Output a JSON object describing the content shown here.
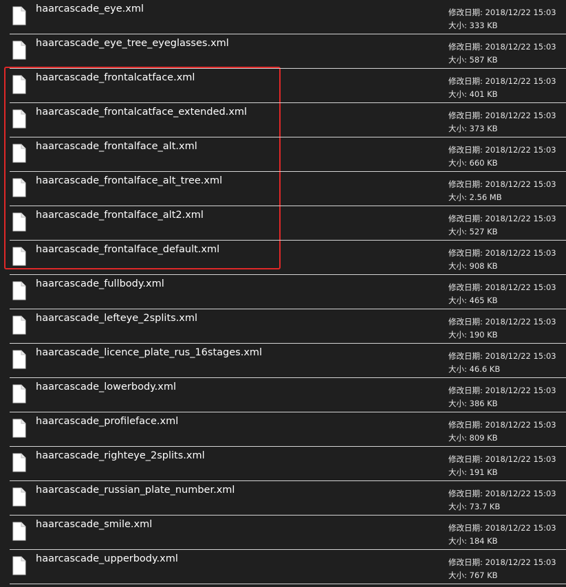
{
  "labels": {
    "modified": "修改日期:",
    "size": "大小:"
  },
  "highlight_color": "#e02828",
  "files": [
    {
      "name": "haarcascade_eye.xml",
      "modified": "2018/12/22 15:03",
      "size": "333 KB",
      "highlighted": false
    },
    {
      "name": "haarcascade_eye_tree_eyeglasses.xml",
      "modified": "2018/12/22 15:03",
      "size": "587 KB",
      "highlighted": false
    },
    {
      "name": "haarcascade_frontalcatface.xml",
      "modified": "2018/12/22 15:03",
      "size": "401 KB",
      "highlighted": true
    },
    {
      "name": "haarcascade_frontalcatface_extended.xml",
      "modified": "2018/12/22 15:03",
      "size": "373 KB",
      "highlighted": true
    },
    {
      "name": "haarcascade_frontalface_alt.xml",
      "modified": "2018/12/22 15:03",
      "size": "660 KB",
      "highlighted": true
    },
    {
      "name": "haarcascade_frontalface_alt_tree.xml",
      "modified": "2018/12/22 15:03",
      "size": "2.56 MB",
      "highlighted": true
    },
    {
      "name": "haarcascade_frontalface_alt2.xml",
      "modified": "2018/12/22 15:03",
      "size": "527 KB",
      "highlighted": true
    },
    {
      "name": "haarcascade_frontalface_default.xml",
      "modified": "2018/12/22 15:03",
      "size": "908 KB",
      "highlighted": true
    },
    {
      "name": "haarcascade_fullbody.xml",
      "modified": "2018/12/22 15:03",
      "size": "465 KB",
      "highlighted": false
    },
    {
      "name": "haarcascade_lefteye_2splits.xml",
      "modified": "2018/12/22 15:03",
      "size": "190 KB",
      "highlighted": false
    },
    {
      "name": "haarcascade_licence_plate_rus_16stages.xml",
      "modified": "2018/12/22 15:03",
      "size": "46.6 KB",
      "highlighted": false
    },
    {
      "name": "haarcascade_lowerbody.xml",
      "modified": "2018/12/22 15:03",
      "size": "386 KB",
      "highlighted": false
    },
    {
      "name": "haarcascade_profileface.xml",
      "modified": "2018/12/22 15:03",
      "size": "809 KB",
      "highlighted": false
    },
    {
      "name": "haarcascade_righteye_2splits.xml",
      "modified": "2018/12/22 15:03",
      "size": "191 KB",
      "highlighted": false
    },
    {
      "name": "haarcascade_russian_plate_number.xml",
      "modified": "2018/12/22 15:03",
      "size": "73.7 KB",
      "highlighted": false
    },
    {
      "name": "haarcascade_smile.xml",
      "modified": "2018/12/22 15:03",
      "size": "184 KB",
      "highlighted": false
    },
    {
      "name": "haarcascade_upperbody.xml",
      "modified": "2018/12/22 15:03",
      "size": "767 KB",
      "highlighted": false
    }
  ]
}
